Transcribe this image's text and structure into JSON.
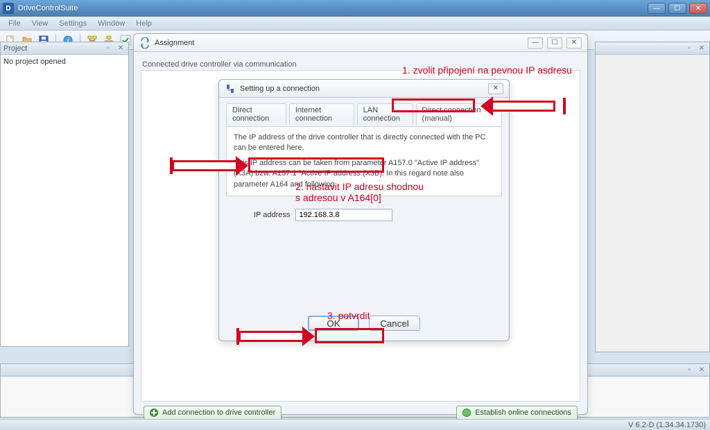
{
  "app": {
    "title": "DriveControlSuite"
  },
  "menu": {
    "file": "File",
    "view": "View",
    "settings": "Settings",
    "window": "Window",
    "help": "Help"
  },
  "toolbar_icons": [
    "new",
    "open",
    "save",
    "info",
    "tree1",
    "tree2",
    "check"
  ],
  "project_panel": {
    "title": "Project",
    "body": "No project opened"
  },
  "right_panel": {
    "title": ""
  },
  "assignment": {
    "title": "Assignment",
    "group_label": "Connected drive controller via communication",
    "footer_add": "Add connection to drive controller",
    "footer_establish": "Establish online connections"
  },
  "conn_dialog": {
    "title": "Setting up a connection",
    "tabs": {
      "direct": "Direct connection",
      "internet": "Internet connection",
      "lan": "LAN connection",
      "manual": "Direct connection (manual)"
    },
    "info_line1": "The IP address of the drive controller that is directly connected with the PC can be entered here.",
    "info_line2": "This IP address can be taken from parameter A157.0 \"Active IP address\" (X3A) bzw. A157.1 \"Active IP address (X3B). In this regard note also parameter A164 and following.",
    "ip_label": "IP address",
    "ip_value": "192.168.3.8",
    "ok": "OK",
    "cancel": "Cancel"
  },
  "annotations": {
    "a1": "1. zvolit připojení na pevnou IP asdresu",
    "a2": "2. nastavit IP adresu shodnou\ns adresou v A164[0]",
    "a3": "3. potvrdit"
  },
  "status": {
    "version": "V 6.2-D (1.34.34.1730)"
  }
}
